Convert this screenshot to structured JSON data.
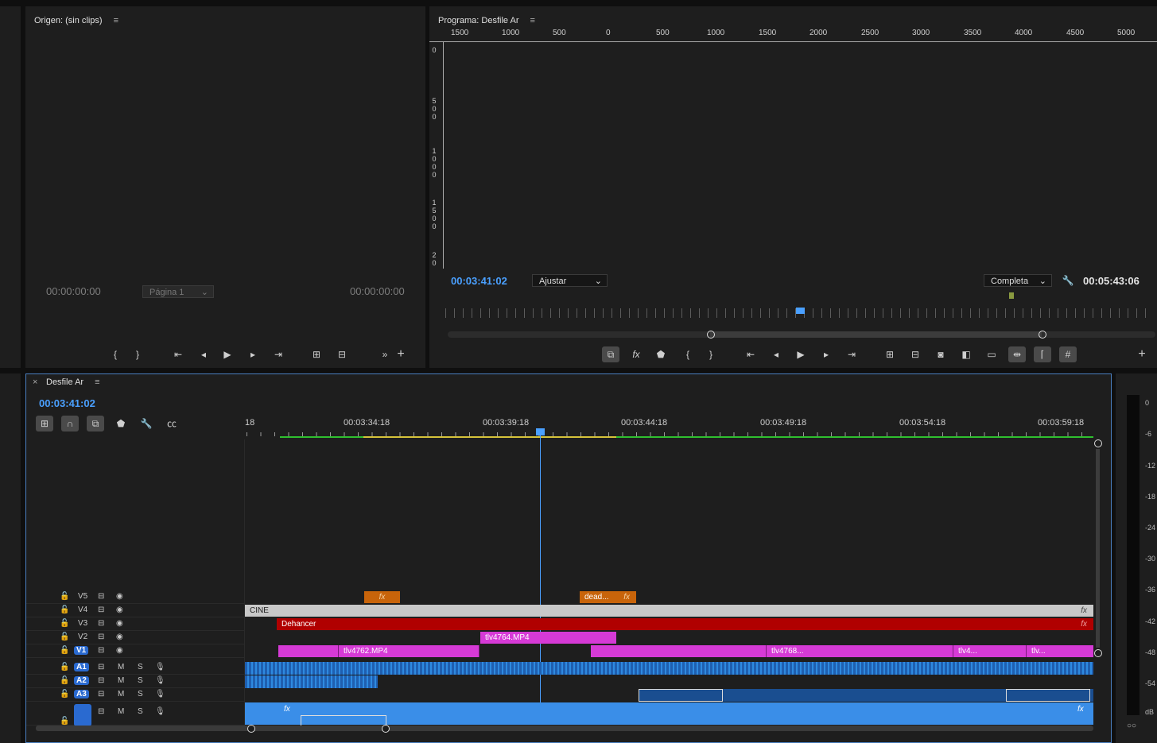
{
  "source": {
    "title": "Origen: (sin clips)",
    "tc_left": "00:00:00:00",
    "tc_right": "00:00:00:00",
    "page_select": "Página 1"
  },
  "program": {
    "title": "Programa: Desfile Ar",
    "tc_current": "00:03:41:02",
    "tc_duration": "00:05:43:06",
    "zoom_select": "Ajustar",
    "quality_select": "Completa",
    "ruler_labels": [
      "1500",
      "1000",
      "500",
      "0",
      "500",
      "1000",
      "1500",
      "2000",
      "2500",
      "3000",
      "3500",
      "4000",
      "4500",
      "5000"
    ],
    "vruler_labels": [
      "0",
      "5\n0\n0",
      "1\n0\n0\n0",
      "1\n5\n0\n0",
      "2\n0"
    ]
  },
  "timeline": {
    "tab_label": "Desfile Ar",
    "close": "×",
    "tc_current": "00:03:41:02",
    "time_labels": [
      "18",
      "00:03:34:18",
      "00:03:39:18",
      "00:03:44:18",
      "00:03:49:18",
      "00:03:54:18",
      "00:03:59:18"
    ],
    "tracks": [
      {
        "name": "V5",
        "type": "video"
      },
      {
        "name": "V4",
        "type": "video"
      },
      {
        "name": "V3",
        "type": "video"
      },
      {
        "name": "V2",
        "type": "video"
      },
      {
        "name": "V1",
        "type": "video",
        "target": true
      },
      {
        "name": "A1",
        "type": "audio",
        "target": true,
        "m": "M",
        "s": "S"
      },
      {
        "name": "A2",
        "type": "audio",
        "target": true,
        "m": "M",
        "s": "S"
      },
      {
        "name": "A3",
        "type": "audio",
        "target": true,
        "m": "M",
        "s": "S"
      },
      {
        "name": "",
        "type": "audio",
        "target": true,
        "m": "M",
        "s": "S"
      }
    ],
    "clips": {
      "v5_fx": "fx",
      "v5_dead": "dead...",
      "v4_cine": "CINE",
      "v3_dehancer": "Dehancer",
      "v2_clip": "tlv4764.MP4",
      "v1_clip1": "tlv4762.MP4",
      "v1_clip2": "tlv4768...",
      "v1_clip3": "tlv4...",
      "v1_clip4": "tlv...",
      "fx": "fx"
    }
  },
  "meter": {
    "labels": [
      "0",
      "-6",
      "-12",
      "-18",
      "-24",
      "-30",
      "-36",
      "-42",
      "-48",
      "-54",
      "dB"
    ],
    "solo": "○○"
  },
  "colors": {
    "accent": "#4aa0ff",
    "clip_pink": "#d63ad6",
    "clip_red": "#b00000",
    "clip_orange": "#c8640a",
    "audio_blue": "#2e8ae0"
  }
}
